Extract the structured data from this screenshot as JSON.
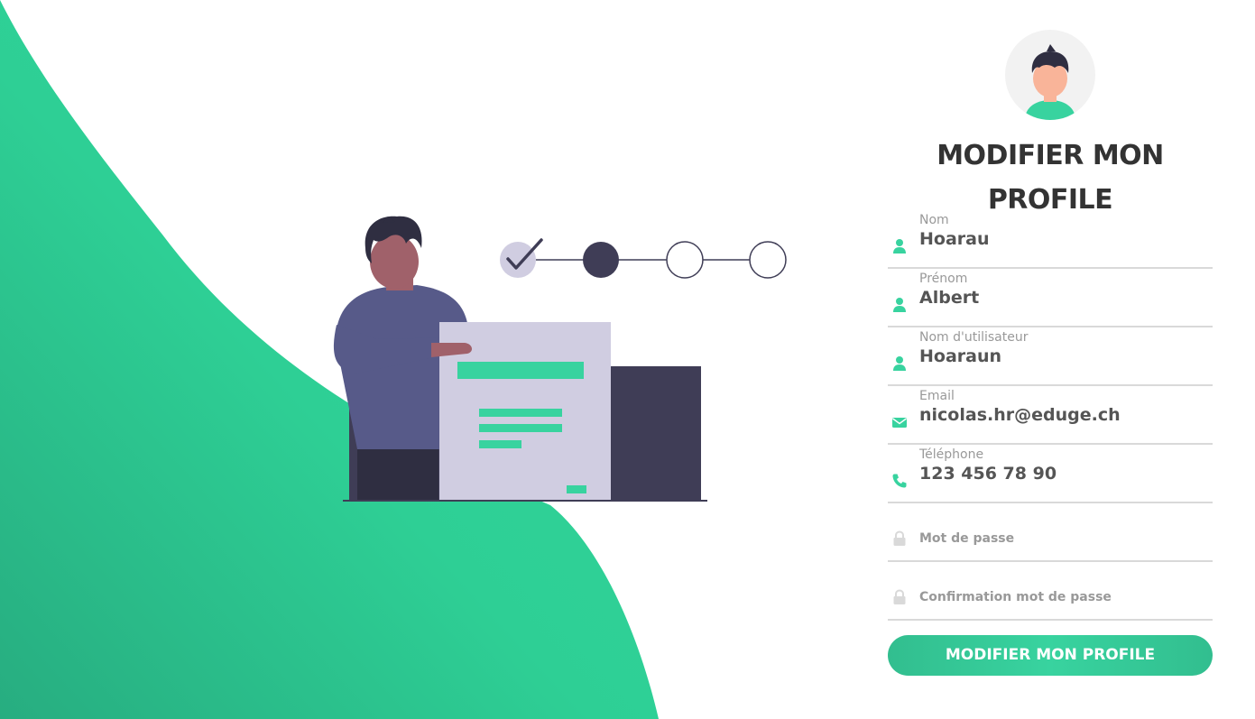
{
  "colors": {
    "accent": "#38d39f",
    "accent_dark": "#32be8f",
    "text_dark": "#333333",
    "text_value": "#555555",
    "text_label": "#999999",
    "underline": "#d9d9d9",
    "icon_muted": "#d9d9d9"
  },
  "illustration": {
    "icon": "profile-form-illustration-icon"
  },
  "form": {
    "avatar_icon": "user-avatar-icon",
    "title_line1": "MODIFIER MON",
    "title_line2": "PROFILE",
    "fields": [
      {
        "label": "Nom",
        "value": "Hoarau",
        "icon": "user-icon"
      },
      {
        "label": "Prénom",
        "value": "Albert",
        "icon": "user-icon"
      },
      {
        "label": "Nom d'utilisateur",
        "value": "Hoaraun",
        "icon": "user-icon"
      },
      {
        "label": "Email",
        "value": "nicolas.hr@eduge.ch",
        "icon": "envelope-icon"
      },
      {
        "label": "Téléphone",
        "value": "123 456 78 90",
        "icon": "phone-icon"
      }
    ],
    "password": {
      "placeholder": "Mot de passe",
      "icon": "lock-icon"
    },
    "password_confirm": {
      "placeholder": "Confirmation mot de passe",
      "icon": "lock-icon"
    },
    "submit_label": "MODIFIER MON PROFILE"
  }
}
